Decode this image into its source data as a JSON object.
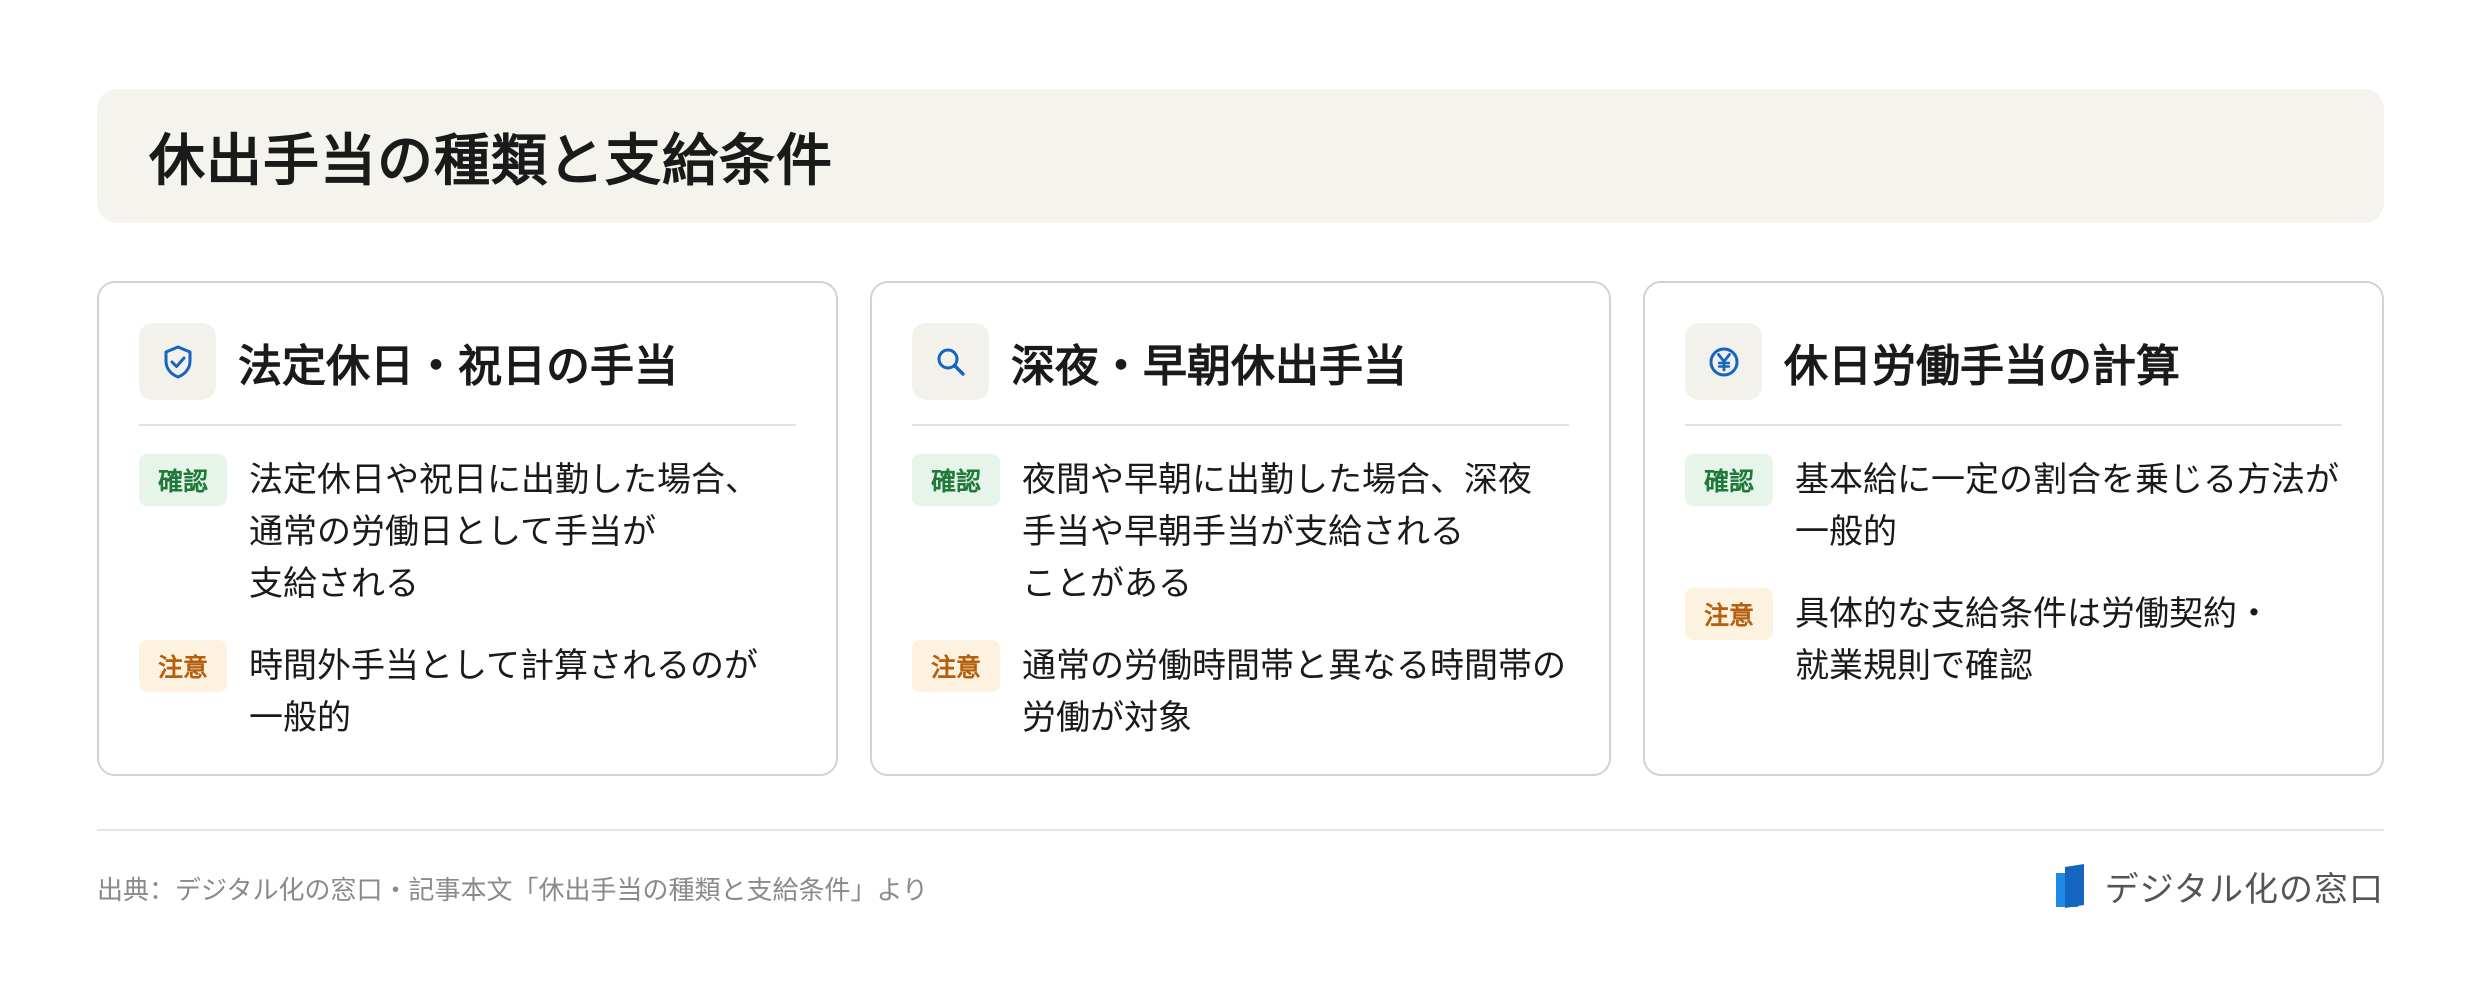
{
  "title": "休出手当の種類と支給条件",
  "cards": [
    {
      "icon": "shield-check-icon",
      "title": "法定休日・祝日の手当",
      "rows": [
        {
          "badge": "確認",
          "lines": [
            "法定休日や祝日に出勤した場合、",
            "通常の労働日として手当が",
            "支給される"
          ]
        },
        {
          "badge": "注意",
          "lines": [
            "時間外手当として計算されるのが",
            "一般的"
          ]
        }
      ]
    },
    {
      "icon": "search-icon",
      "title": "深夜・早朝休出手当",
      "rows": [
        {
          "badge": "確認",
          "lines": [
            "夜間や早朝に出勤した場合、深夜",
            "手当や早朝手当が支給される",
            "ことがある"
          ]
        },
        {
          "badge": "注意",
          "lines": [
            "通常の労働時間帯と異なる時間帯の",
            "労働が対象"
          ]
        }
      ]
    },
    {
      "icon": "yen-icon",
      "title": "休日労働手当の計算",
      "rows": [
        {
          "badge": "確認",
          "lines": [
            "基本給に一定の割合を乗じる方法が",
            "一般的"
          ]
        },
        {
          "badge": "注意",
          "lines": [
            "具体的な支給条件は労働契約・",
            "就業規則で確認"
          ]
        }
      ]
    }
  ],
  "source": "出典：デジタル化の窓口・記事本文「休出手当の種類と支給条件」より",
  "brand": "デジタル化の窓口",
  "colors": {
    "accent": "#1565c0",
    "confirm_bg": "#e6f4ea",
    "confirm_fg": "#1f7a3a",
    "note_bg": "#fdf1e0",
    "note_fg": "#b5600e"
  }
}
